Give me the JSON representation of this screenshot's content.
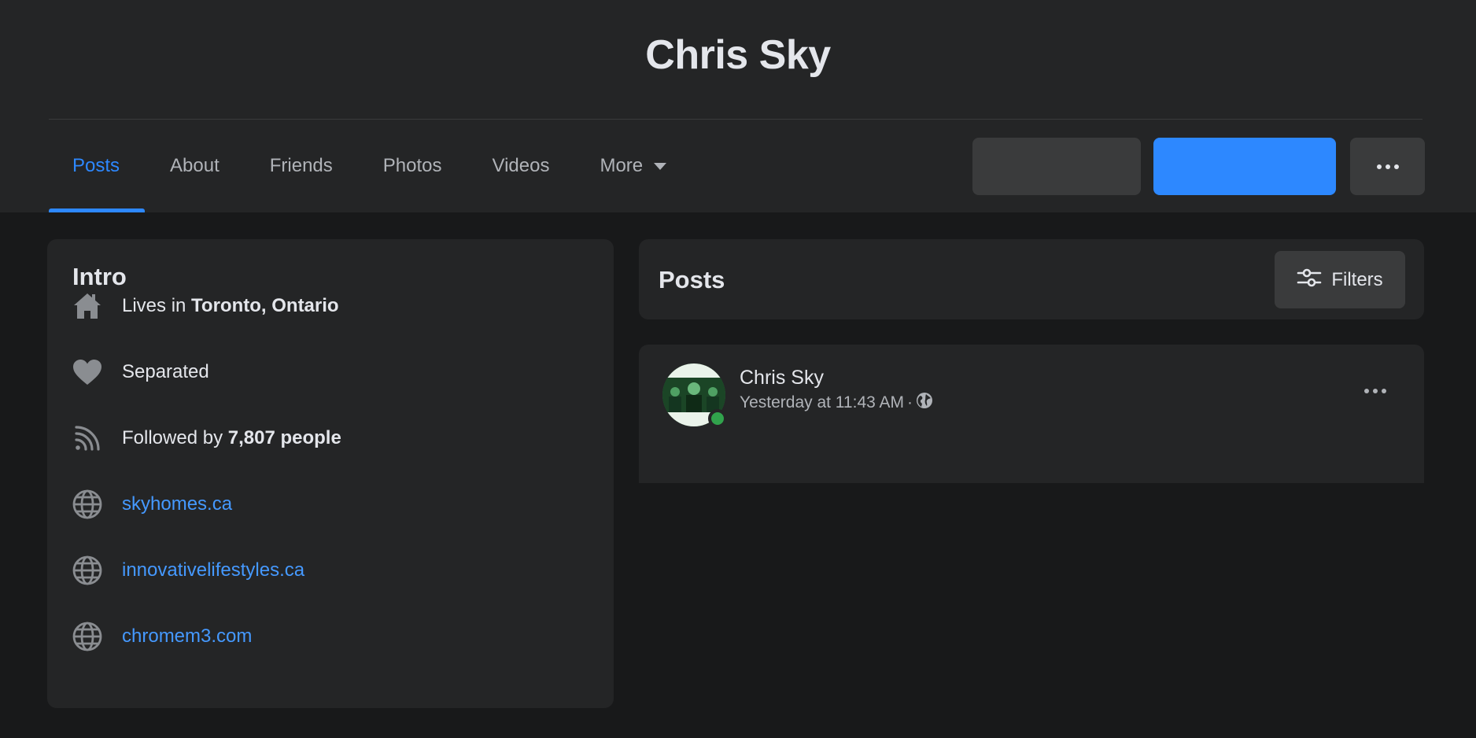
{
  "profile": {
    "name": "Chris Sky"
  },
  "tabs": [
    {
      "label": "Posts",
      "active": true
    },
    {
      "label": "About",
      "active": false
    },
    {
      "label": "Friends",
      "active": false
    },
    {
      "label": "Photos",
      "active": false
    },
    {
      "label": "Videos",
      "active": false
    },
    {
      "label": "More",
      "active": false,
      "icon": "caret-down-icon"
    }
  ],
  "header_actions": {
    "more_icon": "more-horizontal-icon"
  },
  "intro": {
    "title": "Intro",
    "lives_prefix": "Lives in",
    "lives_place": "Toronto, Ontario",
    "relationship": "Separated",
    "followed_prefix": "Followed by",
    "followed_count": "7,807 people",
    "links": [
      "skyhomes.ca",
      "innovativelifestyles.ca",
      "chromem3.com"
    ]
  },
  "posts": {
    "title": "Posts",
    "filters_label": "Filters",
    "items": [
      {
        "author": "Chris Sky",
        "time": "Yesterday at 11:43 AM",
        "separator": "·",
        "audience_icon": "globe-icon",
        "online": true
      }
    ]
  },
  "colors": {
    "page_bg": "#18191a",
    "card_bg": "#242526",
    "button_gray": "#3a3b3c",
    "accent_blue": "#2d88ff",
    "link_blue": "#4599ff",
    "text_primary": "#e4e6eb",
    "text_secondary": "#b0b3b8",
    "online_green": "#31a24c"
  }
}
